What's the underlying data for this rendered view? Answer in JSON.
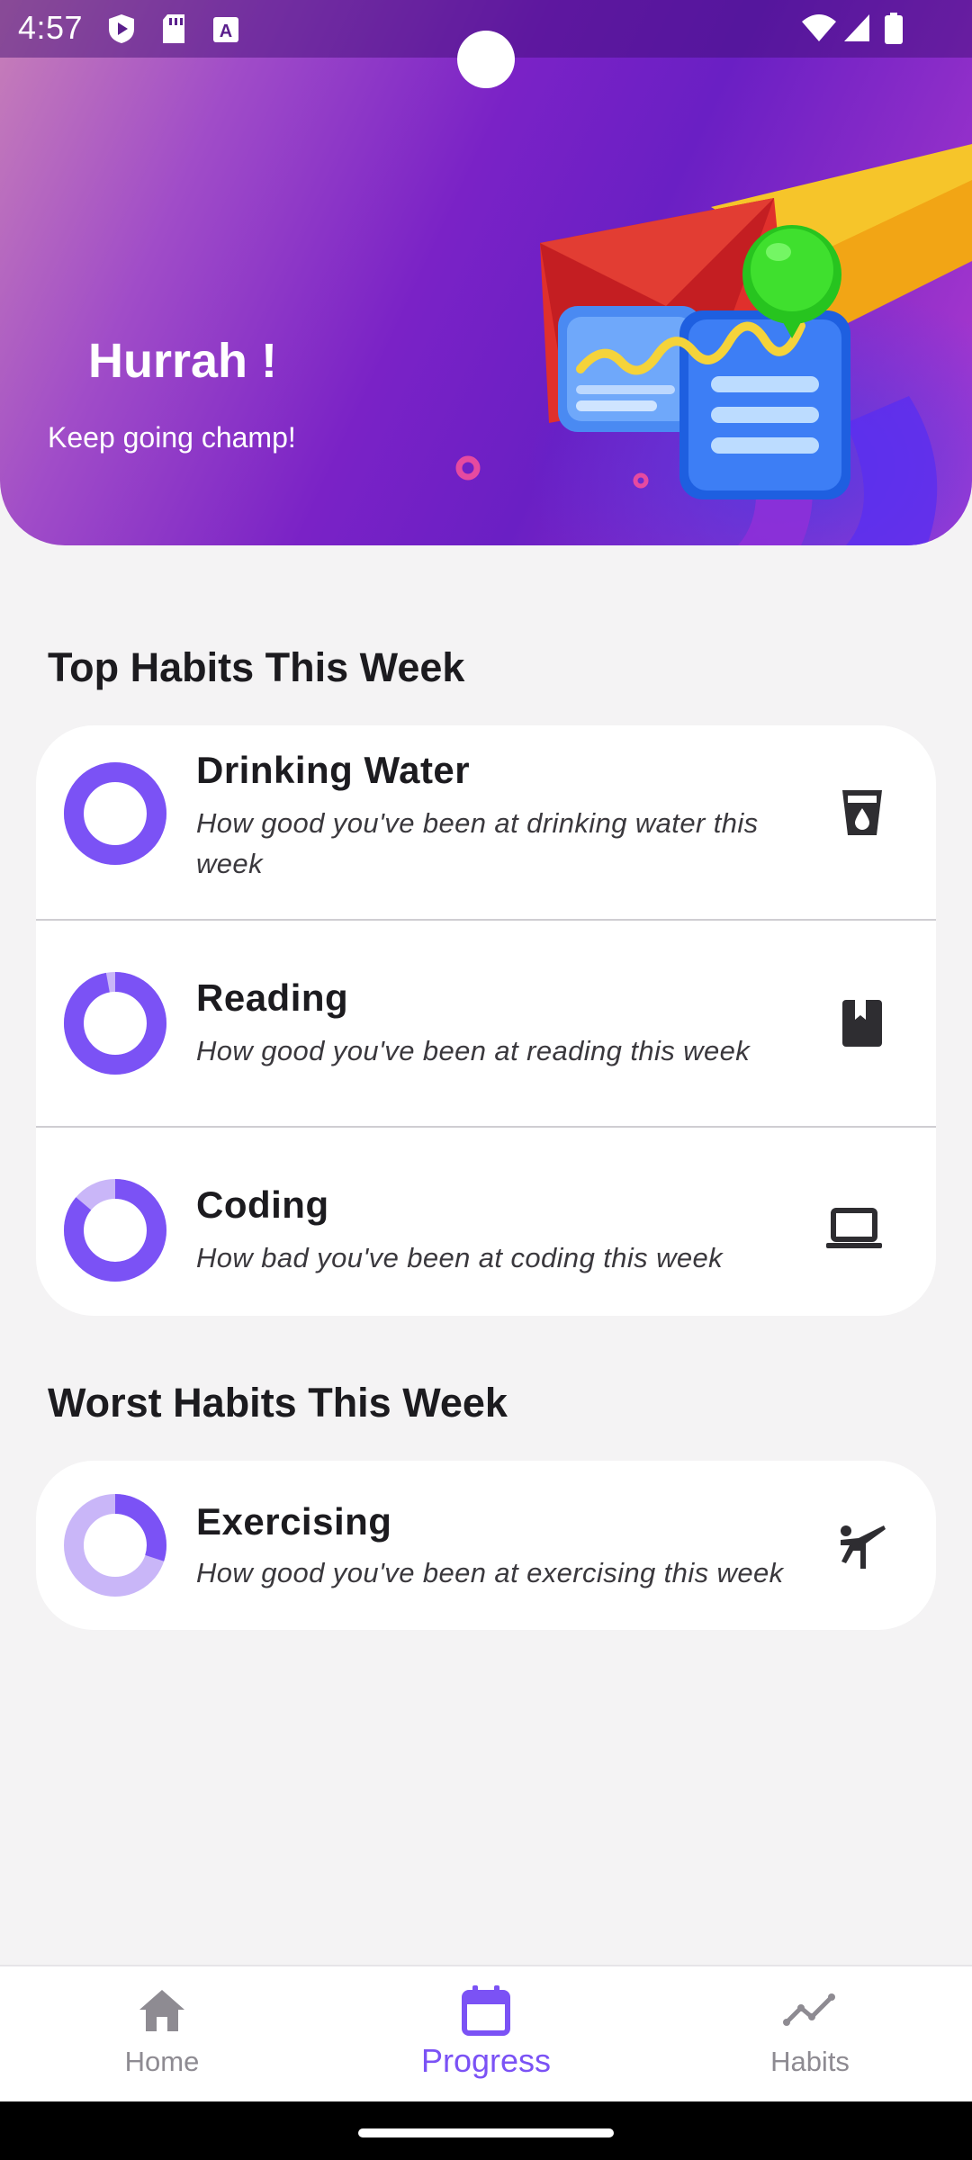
{
  "status_bar": {
    "time": "4:57",
    "icons": [
      "shield-play-icon",
      "sd-card-icon",
      "font-a-icon",
      "wifi-icon",
      "signal-icon",
      "battery-icon"
    ]
  },
  "hero": {
    "title": "Hurrah !",
    "subtitle": "Keep going champ!",
    "illustration": "progress-chart-illustration"
  },
  "colors": {
    "accent": "#7b52f5",
    "ring_track_light": "#c9b6f8",
    "text_primary": "#1c1b1f",
    "nav_inactive": "#8e8b92"
  },
  "top_habits": {
    "title": "Top Habits This Week",
    "items": [
      {
        "name": "Drinking Water",
        "description": "How good you've been at drinking water this week",
        "icon": "water-glass-icon",
        "progress": 1.0
      },
      {
        "name": "Reading",
        "description": "How good you've been at reading this week",
        "icon": "book-icon",
        "progress": 0.97
      },
      {
        "name": "Coding",
        "description": "How bad you've been at coding this week",
        "icon": "laptop-icon",
        "progress": 0.86
      }
    ]
  },
  "worst_habits": {
    "title": "Worst Habits This Week",
    "items": [
      {
        "name": "Exercising",
        "description": "How good you've been at exercising this week",
        "icon": "martial-arts-icon",
        "progress": 0.3
      }
    ]
  },
  "bottom_nav": {
    "items": [
      {
        "label": "Home",
        "icon": "home-icon",
        "active": false
      },
      {
        "label": "Progress",
        "icon": "calendar-icon",
        "active": true
      },
      {
        "label": "Habits",
        "icon": "trend-line-icon",
        "active": false
      }
    ]
  }
}
